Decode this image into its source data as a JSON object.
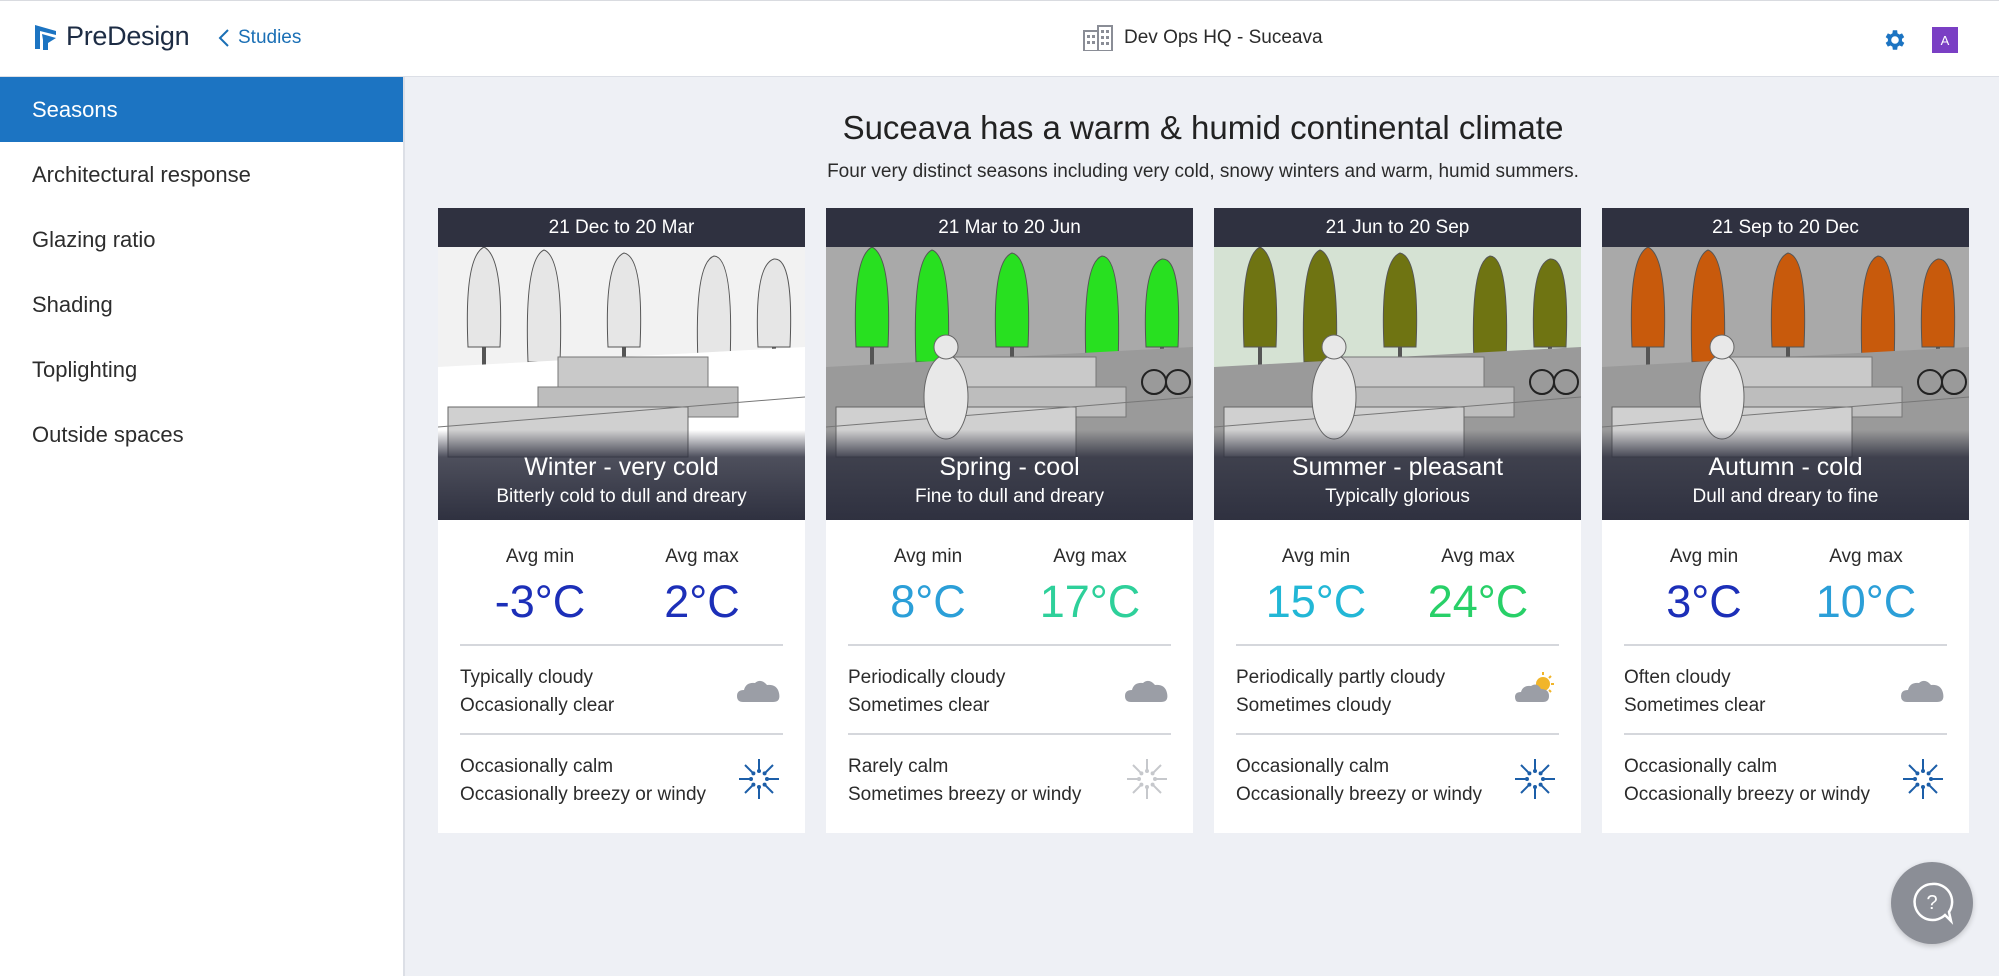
{
  "header": {
    "app_name": "PreDesign",
    "back_label": "Studies",
    "project_name": "Dev Ops HQ - Suceava",
    "avatar_initial": "A",
    "accent": "#1c74c2"
  },
  "sidebar": {
    "items": [
      {
        "label": "Seasons",
        "active": true
      },
      {
        "label": "Architectural response"
      },
      {
        "label": "Glazing ratio"
      },
      {
        "label": "Shading"
      },
      {
        "label": "Toplighting"
      },
      {
        "label": "Outside spaces"
      }
    ]
  },
  "main": {
    "title": "Suceava has a warm & humid continental climate",
    "subtitle": "Four very distinct seasons including very cold, snowy winters and warm, humid summers.",
    "seasons": [
      {
        "dates": "21 Dec to 20 Mar",
        "name": "Winter - very cold",
        "desc": "Bitterly cold to dull and dreary",
        "min_label": "Avg min",
        "min": "-3°C",
        "min_color": "#1c2fb8",
        "max_label": "Avg max",
        "max": "2°C",
        "max_color": "#1c2fb8",
        "cloud_1": "Typically cloudy",
        "cloud_2": "Occasionally clear",
        "cloud_icon": "cloud-icon",
        "wind_1": "Occasionally calm",
        "wind_2": "Occasionally breezy or windy",
        "wind_icon": "wind-calm-icon",
        "tree_color": "#e6e6e6"
      },
      {
        "dates": "21 Mar to 20 Jun",
        "name": "Spring - cool",
        "desc": "Fine to dull and dreary",
        "min_label": "Avg min",
        "min": "8°C",
        "min_color": "#2b9fd8",
        "max_label": "Avg max",
        "max": "17°C",
        "max_color": "#2ed09a",
        "cloud_1": "Periodically cloudy",
        "cloud_2": "Sometimes clear",
        "cloud_icon": "cloud-icon",
        "wind_1": "Rarely calm",
        "wind_2": "Sometimes breezy or windy",
        "wind_icon": "wind-calm-faded-icon",
        "tree_color": "#28e020"
      },
      {
        "dates": "21 Jun to 20 Sep",
        "name": "Summer - pleasant",
        "desc": "Typically glorious",
        "min_label": "Avg min",
        "min": "15°C",
        "min_color": "#22b7d6",
        "max_label": "Avg max",
        "max": "24°C",
        "max_color": "#28d068",
        "cloud_1": "Periodically partly cloudy",
        "cloud_2": "Sometimes cloudy",
        "cloud_icon": "partly-cloudy-icon",
        "wind_1": "Occasionally calm",
        "wind_2": "Occasionally breezy or windy",
        "wind_icon": "wind-calm-icon",
        "tree_color": "#6f7412"
      },
      {
        "dates": "21 Sep to 20 Dec",
        "name": "Autumn - cold",
        "desc": "Dull and dreary to fine",
        "min_label": "Avg min",
        "min": "3°C",
        "min_color": "#1c2fb8",
        "max_label": "Avg max",
        "max": "10°C",
        "max_color": "#2b9fd8",
        "cloud_1": "Often cloudy",
        "cloud_2": "Sometimes clear",
        "cloud_icon": "cloud-icon",
        "wind_1": "Occasionally calm",
        "wind_2": "Occasionally breezy or windy",
        "wind_icon": "wind-calm-icon",
        "tree_color": "#c85a0c"
      }
    ]
  },
  "help": {
    "icon": "help-icon"
  }
}
